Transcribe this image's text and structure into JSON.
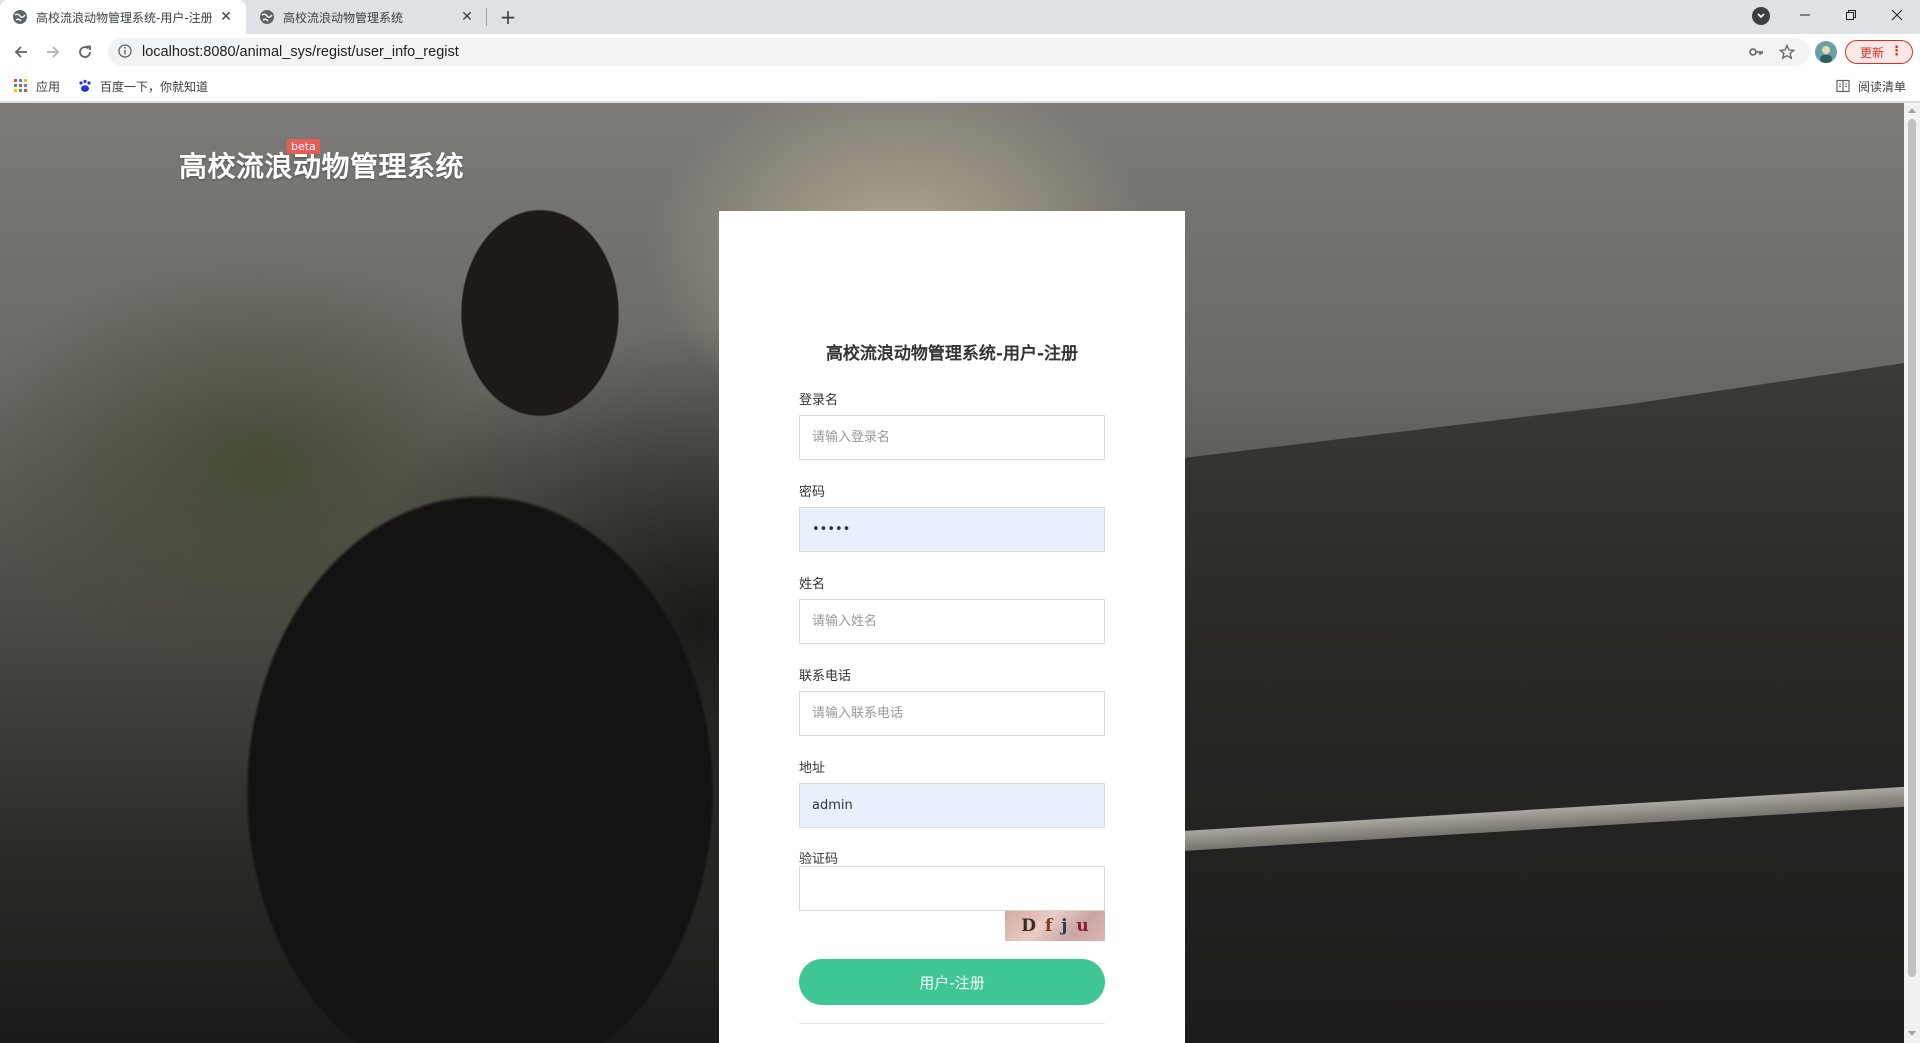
{
  "browser": {
    "tabs": [
      {
        "title": "高校流浪动物管理系统-用户-注册",
        "active": true,
        "icon": "globe-icon"
      },
      {
        "title": "高校流浪动物管理系统",
        "active": false,
        "icon": "globe-icon"
      }
    ],
    "url": "localhost:8080/animal_sys/regist/user_info_regist",
    "update_label": "更新",
    "bookmarks": {
      "apps_label": "应用",
      "baidu_label": "百度一下，你就知道",
      "reading_list_label": "阅读清单"
    }
  },
  "page": {
    "brand": "高校流浪动物管理系统",
    "beta": "beta",
    "form": {
      "title": "高校流浪动物管理系统-用户-注册",
      "fields": [
        {
          "label": "登录名",
          "placeholder": "请输入登录名",
          "value": ""
        },
        {
          "label": "密码",
          "placeholder": "",
          "value": "•••••"
        },
        {
          "label": "姓名",
          "placeholder": "请输入姓名",
          "value": ""
        },
        {
          "label": "联系电话",
          "placeholder": "请输入联系电话",
          "value": ""
        },
        {
          "label": "地址",
          "placeholder": "",
          "value": "admin"
        },
        {
          "label": "验证码",
          "placeholder": "",
          "value": ""
        }
      ],
      "captcha": [
        "D",
        "f",
        "j",
        "u"
      ],
      "submit_label": "用户-注册"
    }
  },
  "colors": {
    "accent": "#3ec795",
    "autofill": "#e8f0fe",
    "beta_badge": "#e85d56",
    "update": "#d93025"
  }
}
